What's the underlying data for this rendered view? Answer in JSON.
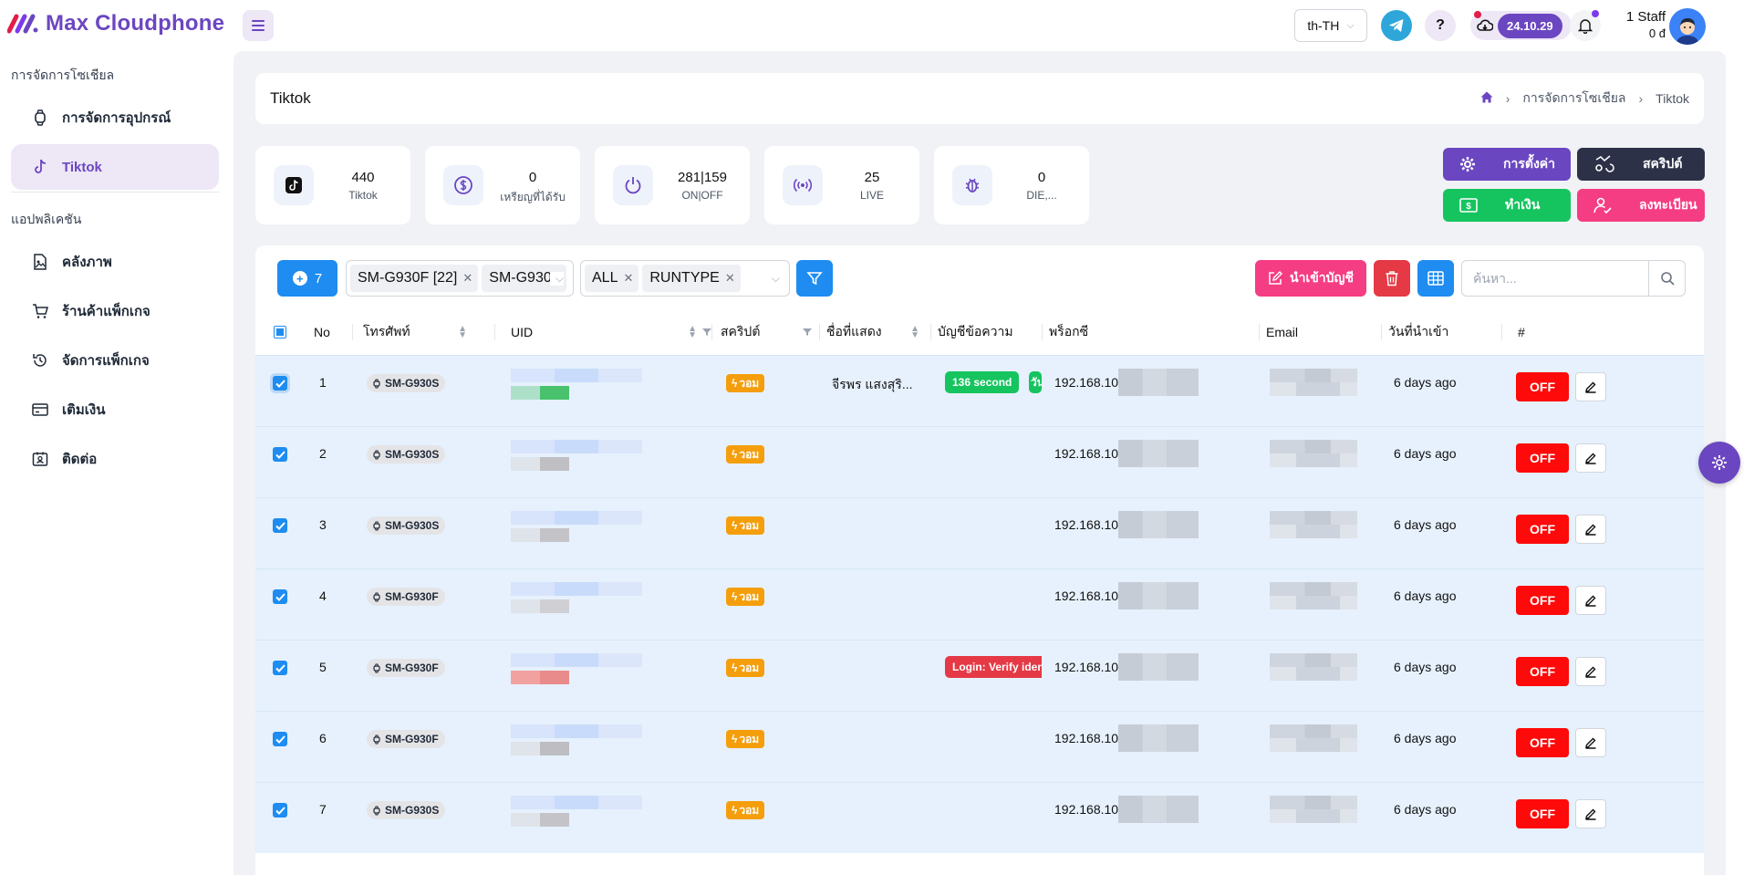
{
  "app": {
    "name": "Max Cloudphone",
    "language": "th-TH",
    "version": "24.10.29",
    "staff_name": "1 Staff",
    "staff_balance": "0 đ",
    "brand_color": "#6b46c1"
  },
  "sidebar": {
    "section1": "การจัดการโซเชียล",
    "section2": "แอปพลิเคชัน",
    "items": [
      {
        "label": "การจัดการอุปกรณ์",
        "icon": "watch-icon"
      },
      {
        "label": "Tiktok",
        "icon": "tiktok-icon",
        "active": true
      },
      {
        "label": "คลังภาพ",
        "icon": "image-file-icon"
      },
      {
        "label": "ร้านค้าแพ็กเกจ",
        "icon": "cart-icon"
      },
      {
        "label": "จัดการแพ็กเกจ",
        "icon": "history-icon"
      },
      {
        "label": "เติมเงิน",
        "icon": "wallet-icon"
      },
      {
        "label": "ติดต่อ",
        "icon": "contact-icon"
      }
    ]
  },
  "page": {
    "title": "Tiktok",
    "breadcrumb": [
      "การจัดการโซเชียล",
      "Tiktok"
    ]
  },
  "stats": [
    {
      "value": "440",
      "label": "Tiktok",
      "icon": "tiktok-icon"
    },
    {
      "value": "0",
      "label": "เหรียญที่ได้รับ",
      "icon": "coin-icon"
    },
    {
      "value": "281|159",
      "label": "ON|OFF",
      "icon": "power-icon"
    },
    {
      "value": "25",
      "label": "LIVE",
      "icon": "broadcast-icon"
    },
    {
      "value": "0",
      "label": "DIE,...",
      "icon": "bug-icon"
    }
  ],
  "actions": {
    "settings": "การตั้งค่า",
    "script": "สคริปต์",
    "pay": "ทำเงิน",
    "register": "ลงทะเบียน"
  },
  "toolbar": {
    "selected_count": "7",
    "device_chips": [
      "SM-G930F [22]",
      "SM-G930S"
    ],
    "type_chips": [
      "ALL",
      "RUNTYPE"
    ],
    "import_label": "นำเข้าบัญชี",
    "search_placeholder": "ค้นหา..."
  },
  "table": {
    "headers": {
      "no": "No",
      "phone": "โทรศัพท์",
      "uid": "UID",
      "script": "สคริปต์",
      "display_name": "ชื่อที่แสดง",
      "message_account": "บัญชีข้อความ",
      "proxy": "พร็อกซี",
      "email": "Email",
      "imported": "วันที่นำเข้า",
      "hash": "#"
    },
    "rows": [
      {
        "no": "1",
        "phone": "SM-G930S",
        "script": "วอม",
        "display_name": "จีรพร แสงสุริ...",
        "msg1": "136 second",
        "msg2": "วัน",
        "proxy": "192.168.10",
        "imported": "6 days ago",
        "status": "OFF"
      },
      {
        "no": "2",
        "phone": "SM-G930S",
        "script": "วอม",
        "display_name": "",
        "msg1": "",
        "msg2": "",
        "proxy": "192.168.10",
        "imported": "6 days ago",
        "status": "OFF"
      },
      {
        "no": "3",
        "phone": "SM-G930S",
        "script": "วอม",
        "display_name": "",
        "msg1": "",
        "msg2": "",
        "proxy": "192.168.10",
        "imported": "6 days ago",
        "status": "OFF"
      },
      {
        "no": "4",
        "phone": "SM-G930F",
        "script": "วอม",
        "display_name": "",
        "msg1": "",
        "msg2": "",
        "proxy": "192.168.10",
        "imported": "6 days ago",
        "status": "OFF"
      },
      {
        "no": "5",
        "phone": "SM-G930F",
        "script": "วอม",
        "display_name": "",
        "msg1": "Login: Verify iden",
        "msg2": "",
        "proxy": "192.168.10",
        "imported": "6 days ago",
        "status": "OFF"
      },
      {
        "no": "6",
        "phone": "SM-G930F",
        "script": "วอม",
        "display_name": "",
        "msg1": "",
        "msg2": "",
        "proxy": "192.168.10",
        "imported": "6 days ago",
        "status": "OFF"
      },
      {
        "no": "7",
        "phone": "SM-G930S",
        "script": "วอม",
        "display_name": "",
        "msg1": "",
        "msg2": "",
        "proxy": "192.168.10",
        "imported": "6 days ago",
        "status": "OFF"
      }
    ]
  }
}
